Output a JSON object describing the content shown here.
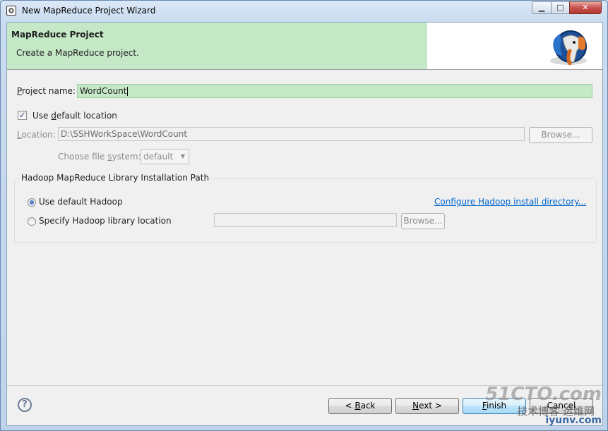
{
  "window": {
    "title": "New MapReduce Project Wizard",
    "minimize": "▁",
    "maximize": "□",
    "close": "✕"
  },
  "banner": {
    "title": "MapReduce Project",
    "description": "Create a MapReduce project.",
    "logo_icon": "hadoop-elephant-icon"
  },
  "project": {
    "label_pre": "",
    "label_mn": "P",
    "label_post": "roject name:",
    "value": "WordCount"
  },
  "location": {
    "use_default_pre": "Use ",
    "use_default_mn": "d",
    "use_default_post": "efault location",
    "use_default_checked": true,
    "label_pre": "",
    "label_mn": "L",
    "label_post": "ocation:",
    "value": "D:\\SSHWorkSpace\\WordCount",
    "browse_label": "Browse...",
    "fs_label_pre": "Choose file ",
    "fs_label_mn": "s",
    "fs_label_post": "ystem:",
    "fs_value": "default"
  },
  "hadoop": {
    "group_title": "Hadoop MapReduce Library Installation Path",
    "use_default_label": "Use default Hadoop",
    "use_default_selected": true,
    "configure_link": "Configure Hadoop install directory...",
    "specify_label": "Specify Hadoop library location",
    "path_value": "",
    "browse_label": "Browse..."
  },
  "footer": {
    "back_pre": "< ",
    "back_mn": "B",
    "back_post": "ack",
    "next_pre": "",
    "next_mn": "N",
    "next_post": "ext >",
    "finish_pre": "",
    "finish_mn": "F",
    "finish_post": "inish",
    "cancel_label": "Cancel"
  },
  "watermark": {
    "line1": "51CTO.com",
    "line2": "技术博客 运维网",
    "line3": "iyunv.com"
  }
}
